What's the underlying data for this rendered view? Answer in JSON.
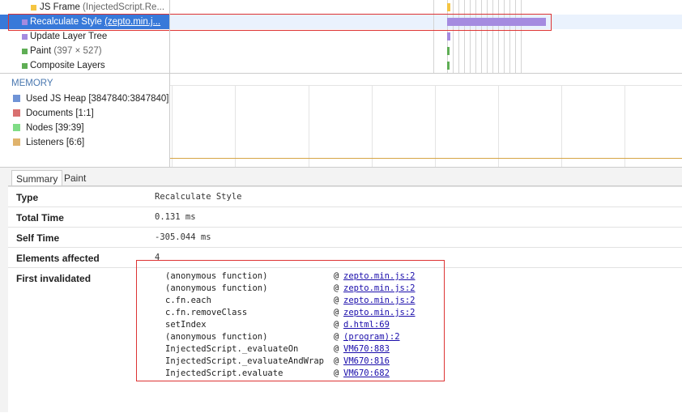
{
  "timeline": {
    "rows": [
      {
        "label": "JS Frame",
        "detail": "(InjectedScript.Re...",
        "color": "#f5c542"
      },
      {
        "label": "Recalculate Style",
        "detail": "(zepto.min.j...",
        "color": "#a58be0",
        "selected": true
      },
      {
        "label": "Update Layer Tree",
        "detail": "",
        "color": "#a58be0"
      },
      {
        "label": "Paint",
        "detail": "(397 × 527)",
        "color": "#5fae55"
      },
      {
        "label": "Composite Layers",
        "detail": "",
        "color": "#5fae55"
      }
    ]
  },
  "memory": {
    "title": "MEMORY",
    "counters": [
      {
        "label": "Used JS Heap [3847840:3847840]",
        "color": "#6f93d6"
      },
      {
        "label": "Documents [1:1]",
        "color": "#d97070"
      },
      {
        "label": "Nodes [39:39]",
        "color": "#7fdc86"
      },
      {
        "label": "Listeners [6:6]",
        "color": "#e0b36c"
      }
    ]
  },
  "details": {
    "tabs": [
      "Summary",
      "Paint Profiler"
    ],
    "rows": [
      {
        "key": "Type",
        "value": "Recalculate Style"
      },
      {
        "key": "Total Time",
        "value": "0.131 ms"
      },
      {
        "key": "Self Time",
        "value": "-305.044 ms"
      },
      {
        "key": "Elements affected",
        "value": "4"
      },
      {
        "key": "First invalidated",
        "value": ""
      }
    ],
    "stack": [
      {
        "fn": "(anonymous function)",
        "src": "zepto.min.js:2"
      },
      {
        "fn": "(anonymous function)",
        "src": "zepto.min.js:2"
      },
      {
        "fn": "c.fn.each",
        "src": "zepto.min.js:2"
      },
      {
        "fn": "c.fn.removeClass",
        "src": "zepto.min.js:2"
      },
      {
        "fn": "setIndex",
        "src": "d.html:69"
      },
      {
        "fn": "(anonymous function)",
        "src": "(program):2"
      },
      {
        "fn": "InjectedScript._evaluateOn",
        "src": "VM670:883"
      },
      {
        "fn": "InjectedScript._evaluateAndWrap",
        "src": "VM670:816"
      },
      {
        "fn": "InjectedScript.evaluate",
        "src": "VM670:682"
      }
    ],
    "at_symbol": "@"
  }
}
